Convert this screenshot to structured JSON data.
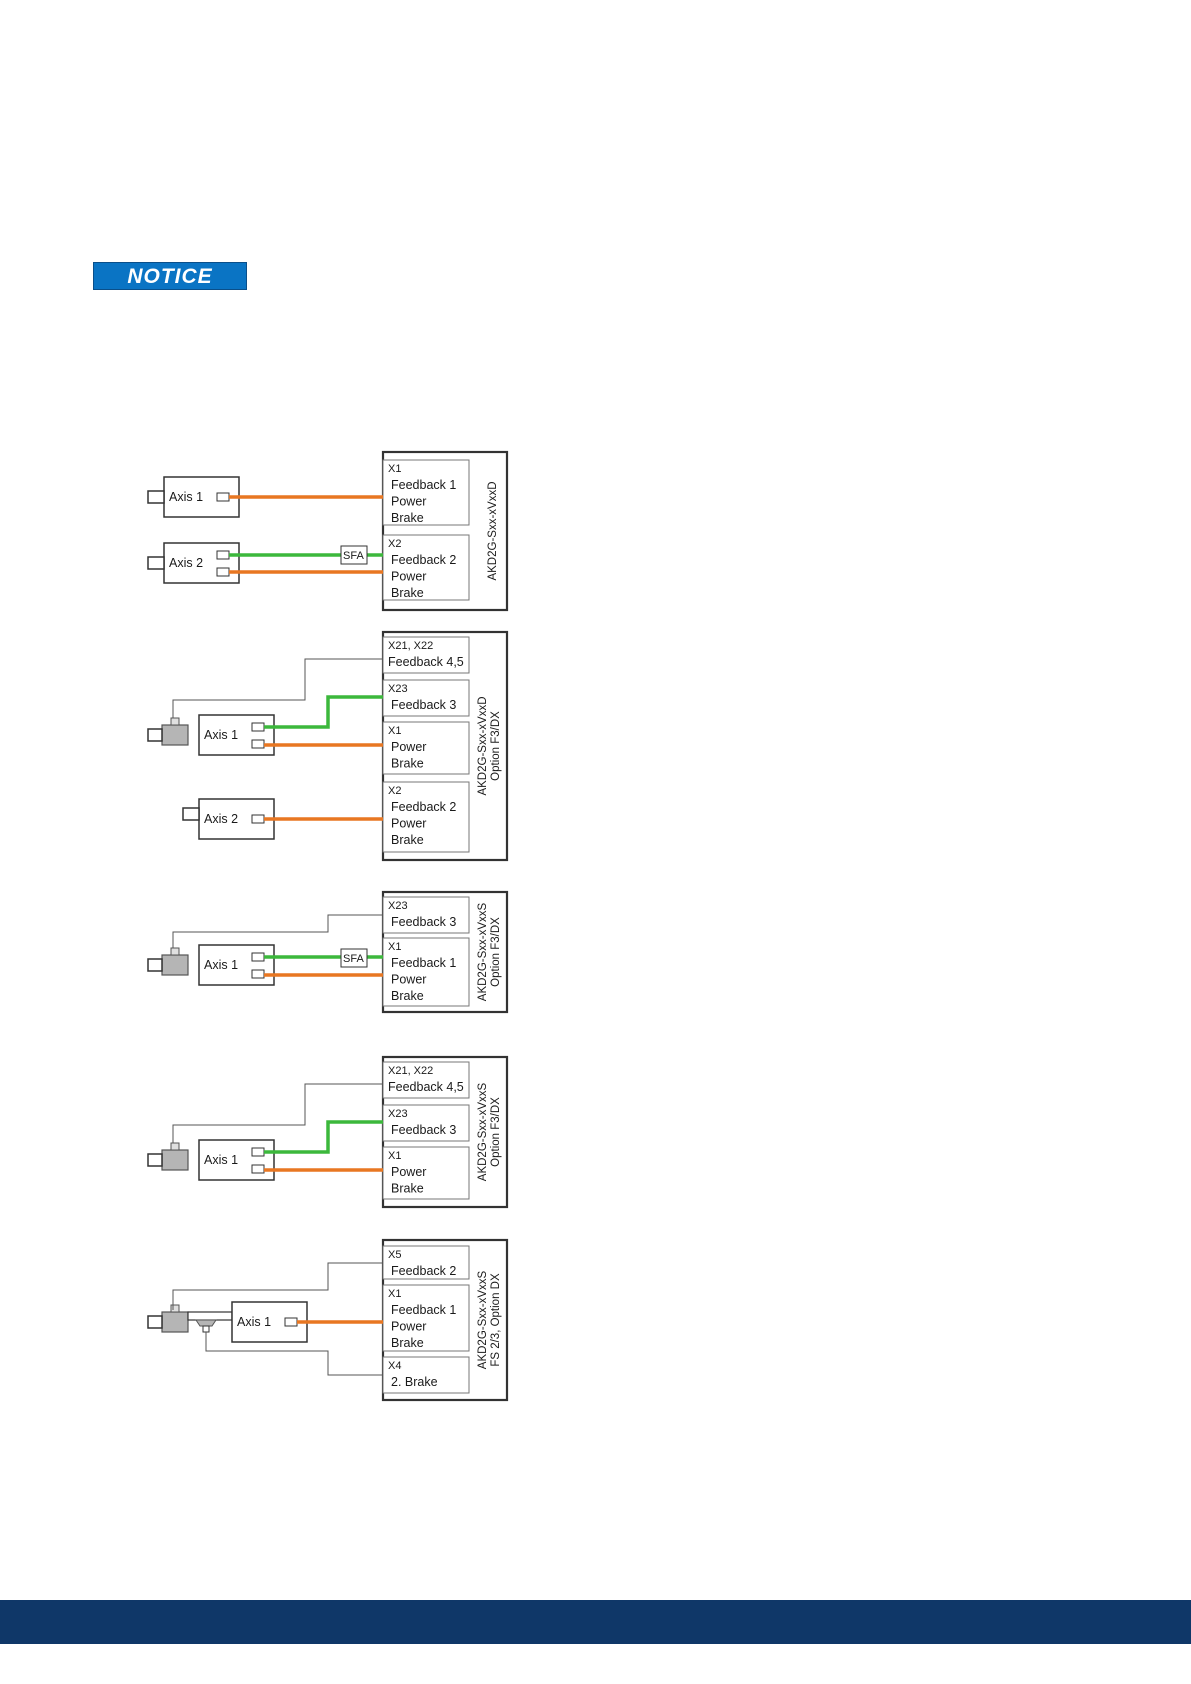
{
  "notice": {
    "label": "NOTICE"
  },
  "colors": {
    "orange": "#e87722",
    "green": "#3cb83c",
    "footer": "#0f3768",
    "notice_bg": "#0a74c4"
  },
  "diagrams": [
    {
      "drive_label": "AKD2G-Sxx-xVxxD",
      "axes": [
        "Axis 1",
        "Axis 2"
      ],
      "blocks": [
        {
          "conn": "X1",
          "lines": [
            "Feedback 1",
            "Power",
            "Brake"
          ]
        },
        {
          "conn": "X2",
          "lines": [
            "Feedback 2",
            "Power",
            "Brake"
          ]
        }
      ],
      "adapter": "SFA"
    },
    {
      "drive_label": "AKD2G-Sxx-xVxxD",
      "drive_option": "Option F3/DX",
      "axes": [
        "Axis 1",
        "Axis 2"
      ],
      "blocks": [
        {
          "conn": "X21, X22",
          "lines": [
            "Feedback 4,5"
          ]
        },
        {
          "conn": "X23",
          "lines": [
            "Feedback 3"
          ]
        },
        {
          "conn": "X1",
          "lines": [
            "Power",
            "Brake"
          ]
        },
        {
          "conn": "X2",
          "lines": [
            "Feedback 2",
            "Power",
            "Brake"
          ]
        }
      ]
    },
    {
      "drive_label": "AKD2G-Sxx-xVxxS",
      "drive_option": "Option F3/DX",
      "axes": [
        "Axis 1"
      ],
      "blocks": [
        {
          "conn": "X23",
          "lines": [
            "Feedback 3"
          ]
        },
        {
          "conn": "X1",
          "lines": [
            "Feedback 1",
            "Power",
            "Brake"
          ]
        }
      ],
      "adapter": "SFA"
    },
    {
      "drive_label": "AKD2G-Sxx-xVxxS",
      "drive_option": "Option F3/DX",
      "axes": [
        "Axis 1"
      ],
      "blocks": [
        {
          "conn": "X21, X22",
          "lines": [
            "Feedback 4,5"
          ]
        },
        {
          "conn": "X23",
          "lines": [
            "Feedback 3"
          ]
        },
        {
          "conn": "X1",
          "lines": [
            "Power",
            "Brake"
          ]
        }
      ]
    },
    {
      "drive_label": "AKD2G-Sxx-xVxxS",
      "drive_option": "FS 2/3, Option DX",
      "axes": [
        "Axis 1"
      ],
      "blocks": [
        {
          "conn": "X5",
          "lines": [
            "Feedback 2"
          ]
        },
        {
          "conn": "X1",
          "lines": [
            "Feedback 1",
            "Power",
            "Brake"
          ]
        },
        {
          "conn": "X4",
          "lines": [
            "2. Brake"
          ]
        }
      ]
    }
  ]
}
